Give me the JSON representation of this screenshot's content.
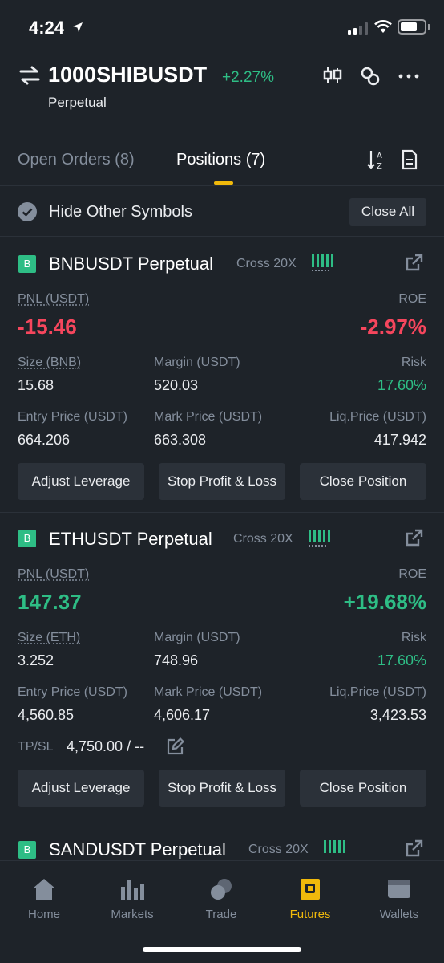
{
  "status": {
    "time": "4:24"
  },
  "header": {
    "symbol": "1000SHIBUSDT",
    "change": "+2.27%",
    "subtitle": "Perpetual"
  },
  "tabs": [
    {
      "label": "Open Orders (8)"
    },
    {
      "label": "Positions (7)"
    }
  ],
  "filter": {
    "label": "Hide Other Symbols",
    "close_all": "Close All"
  },
  "positions": [
    {
      "badge": "B",
      "title": "BNBUSDT Perpetual",
      "mode": "Cross 20X",
      "pnl_label": "PNL (USDT)",
      "pnl": "-15.46",
      "roe_label": "ROE",
      "roe": "-2.97%",
      "size_label": "Size (BNB)",
      "size": "15.68",
      "margin_label": "Margin (USDT)",
      "margin": "520.03",
      "risk_label": "Risk",
      "risk": "17.60%",
      "entry_label": "Entry Price (USDT)",
      "entry": "664.206",
      "mark_label": "Mark Price (USDT)",
      "mark": "663.308",
      "liq_label": "Liq.Price (USDT)",
      "liq": "417.942",
      "btn_leverage": "Adjust Leverage",
      "btn_tpsl": "Stop Profit & Loss",
      "btn_close": "Close Position"
    },
    {
      "badge": "B",
      "title": "ETHUSDT Perpetual",
      "mode": "Cross 20X",
      "pnl_label": "PNL (USDT)",
      "pnl": "147.37",
      "roe_label": "ROE",
      "roe": "+19.68%",
      "size_label": "Size (ETH)",
      "size": "3.252",
      "margin_label": "Margin (USDT)",
      "margin": "748.96",
      "risk_label": "Risk",
      "risk": "17.60%",
      "entry_label": "Entry Price (USDT)",
      "entry": "4,560.85",
      "mark_label": "Mark Price (USDT)",
      "mark": "4,606.17",
      "liq_label": "Liq.Price (USDT)",
      "liq": "3,423.53",
      "tpsl_label": "TP/SL",
      "tpsl": "4,750.00 / --",
      "btn_leverage": "Adjust Leverage",
      "btn_tpsl": "Stop Profit & Loss",
      "btn_close": "Close Position"
    },
    {
      "badge": "B",
      "title": "SANDUSDT Perpetual",
      "mode": "Cross 20X"
    }
  ],
  "tabbar": [
    {
      "label": "Home",
      "icon": "home-icon"
    },
    {
      "label": "Markets",
      "icon": "markets-icon"
    },
    {
      "label": "Trade",
      "icon": "trade-icon"
    },
    {
      "label": "Futures",
      "icon": "futures-icon"
    },
    {
      "label": "Wallets",
      "icon": "wallets-icon"
    }
  ],
  "colors": {
    "accent": "#f0b90b",
    "up": "#2ebd85",
    "down": "#f6465d",
    "bg": "#1e2329",
    "panel": "#2b3139"
  }
}
